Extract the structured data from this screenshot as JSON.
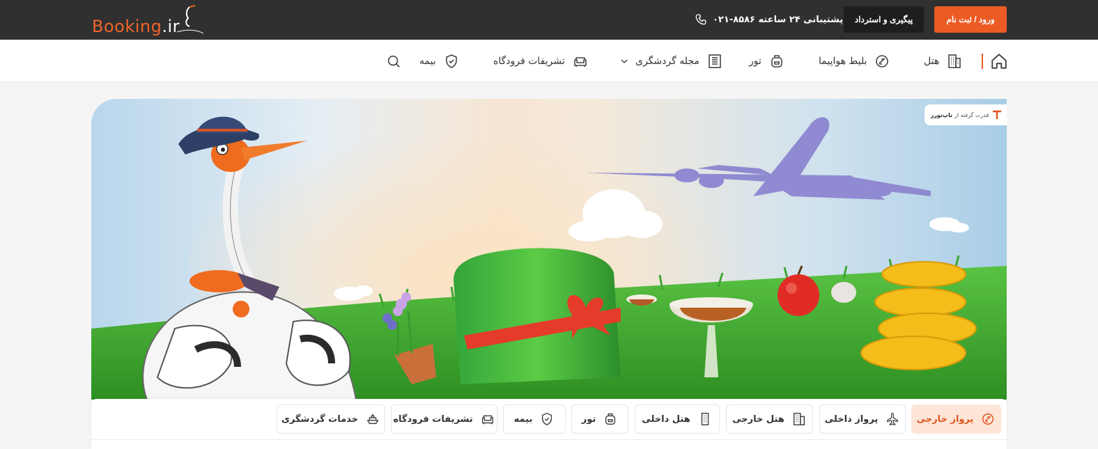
{
  "header": {
    "logo": {
      "brand": "Booking",
      "tld": ".ir"
    },
    "login_button": "ورود / ثبت نام",
    "track_button": "پیگیری و استرداد",
    "support_text": "پشتیبانی ۲۴ ساعته ۸۵۸۶-۰۲۱",
    "phone_icon": "phone-icon"
  },
  "nav": {
    "items": [
      {
        "label": "هتل",
        "icon": "building-icon"
      },
      {
        "label": "بلیط هواپیما",
        "icon": "plane-icon"
      },
      {
        "label": "تور",
        "icon": "luggage-icon"
      },
      {
        "label": "مجله گردشگری",
        "icon": "magazine-icon"
      },
      {
        "label": "تشریفات فرودگاه",
        "icon": "sofa-icon"
      },
      {
        "label": "بیمه",
        "icon": "shield-icon"
      }
    ]
  },
  "hero": {
    "powered_by_prefix": "قدرت گرفته از",
    "powered_by_brand": "تاپ‌تورز"
  },
  "tabs": [
    {
      "label": "پرواز خارجی",
      "icon": "plane-global-icon",
      "active": true
    },
    {
      "label": "پرواز داخلی",
      "icon": "plane-icon",
      "active": false
    },
    {
      "label": "هتل خارجی",
      "icon": "building-icon",
      "active": false
    },
    {
      "label": "هتل داخلی",
      "icon": "building-small-icon",
      "active": false
    },
    {
      "label": "تور",
      "icon": "luggage-icon",
      "active": false
    },
    {
      "label": "بیمه",
      "icon": "shield-icon",
      "active": false
    },
    {
      "label": "تشریفات فرودگاه",
      "icon": "sofa-icon",
      "active": false
    },
    {
      "label": "خدمات گردشگری",
      "icon": "ship-icon",
      "active": false
    }
  ],
  "colors": {
    "accent": "#ec5b24",
    "dark": "#303030",
    "active_tab_bg": "#fde6d8"
  }
}
